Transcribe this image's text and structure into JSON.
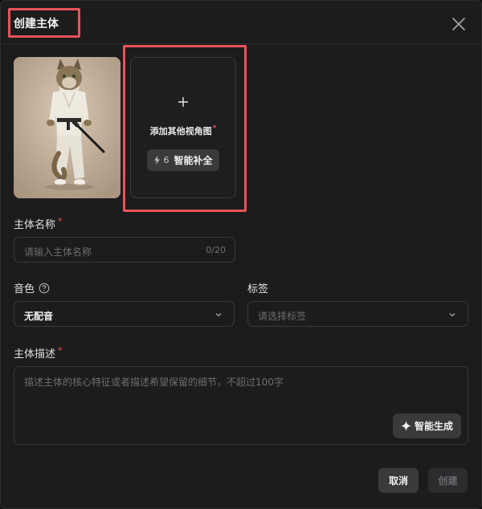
{
  "dialog": {
    "title": "创建主体"
  },
  "reference": {
    "add_view_label": "添加其他视角图",
    "required_mark": "*",
    "smart_fill": {
      "count": "6",
      "label": "智能补全"
    }
  },
  "name_field": {
    "label": "主体名称",
    "required_mark": "*",
    "placeholder": "请输入主体名称",
    "counter": "0/20"
  },
  "voice_field": {
    "label": "音色",
    "value": "无配音"
  },
  "tag_field": {
    "label": "标签",
    "placeholder": "请选择标签"
  },
  "description_field": {
    "label": "主体描述",
    "required_mark": "*",
    "placeholder": "描述主体的核心特征或者描述希望保留的细节，不超过100字",
    "ai_button": "智能生成"
  },
  "footer": {
    "cancel": "取消",
    "create": "创建"
  },
  "colors": {
    "background": "#1c1c1d",
    "highlight": "#e9535a",
    "required": "#e9535a",
    "button": "#3a3a3c"
  }
}
